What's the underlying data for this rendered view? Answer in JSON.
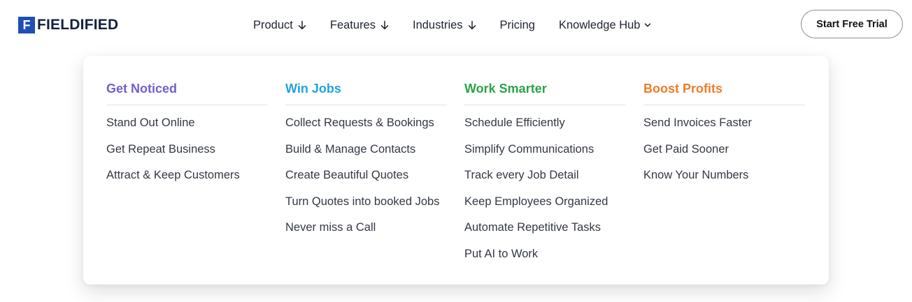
{
  "brand": {
    "logo_mark": "F",
    "name": "FIELDIFIED",
    "logo_color": "#1f4fb4"
  },
  "nav": {
    "items": [
      {
        "label": "Product",
        "icon": "arrow-down-icon"
      },
      {
        "label": "Features",
        "icon": "arrow-down-icon"
      },
      {
        "label": "Industries",
        "icon": "arrow-down-icon"
      },
      {
        "label": "Pricing",
        "icon": ""
      },
      {
        "label": "Knowledge Hub",
        "icon": "chevron-down-icon"
      }
    ],
    "cta_label": "Start Free Trial"
  },
  "menu": {
    "columns": [
      {
        "title": "Get Noticed",
        "color": "#6f5fd0",
        "items": [
          "Stand Out Online",
          "Get Repeat Business",
          "Attract & Keep Customers"
        ]
      },
      {
        "title": "Win Jobs",
        "color": "#21a4d8",
        "items": [
          "Collect Requests & Bookings",
          "Build & Manage Contacts",
          "Create Beautiful Quotes",
          "Turn Quotes into booked Jobs",
          "Never miss a Call"
        ]
      },
      {
        "title": "Work Smarter",
        "color": "#2aa44a",
        "items": [
          "Schedule Efficiently",
          "Simplify Communications",
          "Track every Job Detail",
          "Keep Employees Organized",
          "Automate Repetitive Tasks",
          "Put AI to Work"
        ]
      },
      {
        "title": "Boost Profits",
        "color": "#ef7d2b",
        "items": [
          "Send Invoices Faster",
          "Get Paid Sooner",
          "Know Your Numbers"
        ]
      }
    ]
  }
}
